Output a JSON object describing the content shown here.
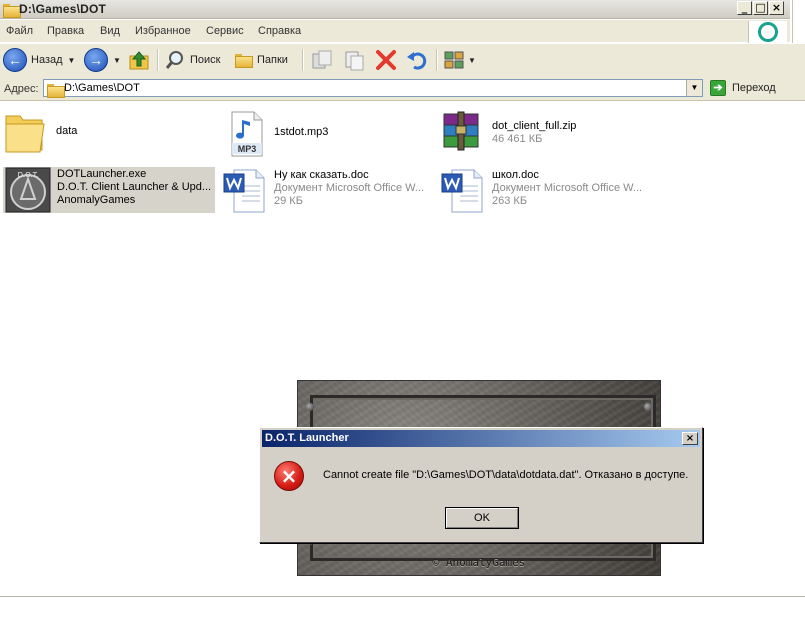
{
  "window": {
    "title": "D:\\Games\\DOT",
    "minimize_glyph": "_",
    "maximize_glyph": "□",
    "close_glyph": "×"
  },
  "menu": [
    "Файл",
    "Правка",
    "Вид",
    "Избранное",
    "Сервис",
    "Справка"
  ],
  "toolbar": {
    "back_label": "Назад",
    "search_label": "Поиск",
    "folders_label": "Папки"
  },
  "address": {
    "label": "Адрес:",
    "value": "D:\\Games\\DOT",
    "go_label": "Переход"
  },
  "files": [
    {
      "name": "data",
      "line2": "",
      "line3": "",
      "icon": "folder-icon"
    },
    {
      "name": "1stdot.mp3",
      "line2": "",
      "line3": "",
      "icon": "mp3-icon",
      "icon_text": "MP3"
    },
    {
      "name": "dot_client_full.zip",
      "line2": "46 461 КБ",
      "line3": "",
      "icon": "winrar-icon"
    },
    {
      "name": "DOTLauncher.exe",
      "line2": "D.O.T. Client Launcher & Upd...",
      "line3": "AnomalyGames",
      "icon": "dot-launcher-icon",
      "icon_text": "D.O.T."
    },
    {
      "name": "Ну как сказать.doc",
      "line2": "Документ Microsoft Office W...",
      "line3": "29 КБ",
      "icon": "word-doc-icon"
    },
    {
      "name": "школ.doc",
      "line2": "Документ Microsoft Office W...",
      "line3": "263 КБ",
      "icon": "word-doc-icon"
    }
  ],
  "splash": {
    "copyright": "© AnomalyGames"
  },
  "dialog": {
    "title": "D.O.T. Launcher",
    "close_glyph": "×",
    "error_glyph": "×",
    "message": "Cannot create file \"D:\\Games\\DOT\\data\\dotdata.dat\". Отказано в доступе.",
    "ok_label": "OK"
  },
  "colors": {
    "dialog_title_start": "#0a246a",
    "dialog_title_end": "#a6caf0",
    "selection": "#d6d3ca",
    "error_red": "#d21a12",
    "go_green": "#3aa63a"
  }
}
